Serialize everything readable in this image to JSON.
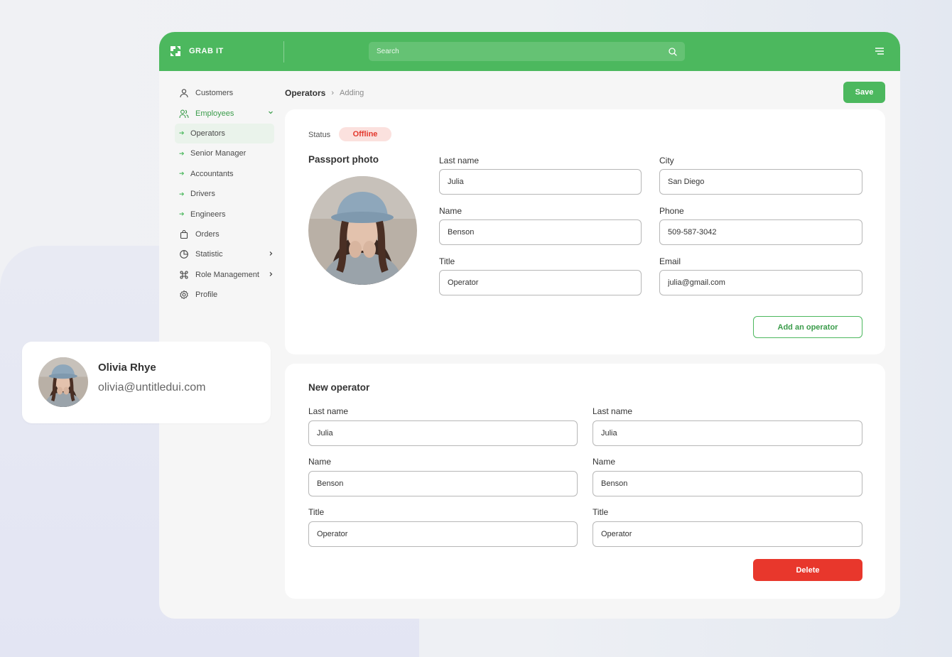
{
  "app": {
    "brand": "GRAB IT",
    "search_placeholder": "Search"
  },
  "sidebar": {
    "items": [
      {
        "label": "Customers"
      },
      {
        "label": "Employees"
      },
      {
        "label": "Operators"
      },
      {
        "label": "Senior Manager"
      },
      {
        "label": "Accountants"
      },
      {
        "label": "Drivers"
      },
      {
        "label": "Engineers"
      },
      {
        "label": "Orders"
      },
      {
        "label": "Statistic"
      },
      {
        "label": "Role Management"
      },
      {
        "label": "Profile"
      }
    ]
  },
  "breadcrumb": {
    "main": "Operators",
    "current": "Adding"
  },
  "toolbar": {
    "save_label": "Save"
  },
  "operator_form": {
    "status_label": "Status",
    "status_value": "Offline",
    "photo_title": "Passport photo",
    "last_name_label": "Last name",
    "last_name_value": "Julia",
    "name_label": "Name",
    "name_value": "Benson",
    "title_label": "Title",
    "title_value": "Operator",
    "city_label": "City",
    "city_value": "San Diego",
    "phone_label": "Phone",
    "phone_value": "509-587-3042",
    "email_label": "Email",
    "email_value": "julia@gmail.com",
    "add_label": "Add an operator"
  },
  "new_operator": {
    "title": "New operator",
    "left": {
      "last_name_label": "Last name",
      "last_name_value": "Julia",
      "name_label": "Name",
      "name_value": "Benson",
      "title_label": "Title",
      "title_value": "Operator"
    },
    "right": {
      "last_name_label": "Last name",
      "last_name_value": "Julia",
      "name_label": "Name",
      "name_value": "Benson",
      "title_label": "Title",
      "title_value": "Operator"
    },
    "delete_label": "Delete"
  },
  "profile_card": {
    "name": "Olivia Rhye",
    "email": "olivia@untitledui.com"
  },
  "colors": {
    "brand_green": "#4cb85e",
    "danger_red": "#e8372c",
    "status_offline_bg": "#fbe1de"
  }
}
